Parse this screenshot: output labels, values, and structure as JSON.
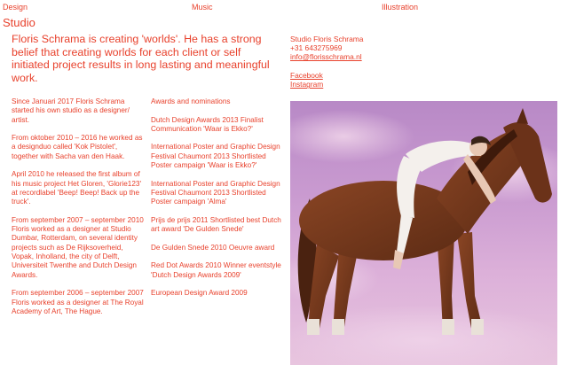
{
  "nav": {
    "design": "Design",
    "music": "Music",
    "illustration": "Illustration"
  },
  "studio_title": "Studio",
  "intro": "Floris Schrama is creating 'worlds'. He has a strong belief that creating worlds for each client or self initiated project results in long lasting and meaningful work.",
  "contact": {
    "name": "Studio Floris Schrama",
    "phone": "+31 643275969",
    "email": "info@florisschrama.nl"
  },
  "social": {
    "facebook": "Facebook",
    "instagram": "Instagram"
  },
  "bio": [
    "Since Januari 2017 Floris Schrama started his own studio as a designer/ artist.",
    "From oktober 2010 – 2016 he worked as a designduo called 'Kok Pistolet', together with Sacha van den Haak.",
    "April 2010 he released the first album of his music project Het Gloren, 'Glorie123' at recordlabel 'Beep! Beep! Back up the truck'.",
    "From september 2007 – september 2010 Floris worked as a designer at Studio Dumbar, Rotterdam, on several identity projects such as De Rijksoverheid, Vopak, Inholland, the city of Delft, Universiteit Twenthe and Dutch Design Awards.",
    "From september 2006 – september 2007 Floris worked as a designer at The Royal Academy of Art, The Hague."
  ],
  "awards": [
    "Awards and nominations",
    "Dutch Design Awards 2013 Finalist Communication 'Waar is Ekko?'",
    "International Poster and Graphic Design Festival Chaumont 2013 Shortlisted Poster campaign 'Waar is Ekko?'",
    "International Poster and Graphic Design Festival Chaumont 2013 Shortlisted Poster campaign 'Alma'",
    "Prijs de prijs 2011 Shortlisted best Dutch art award 'De Gulden Snede'",
    "De Gulden Snede 2010 Oeuvre award",
    "Red Dot Awards 2010 Winner eventstyle 'Dutch Design Awards 2009'",
    "European Design Award 2009"
  ],
  "colors": {
    "accent": "#e8412c",
    "background": "#ffffff"
  }
}
